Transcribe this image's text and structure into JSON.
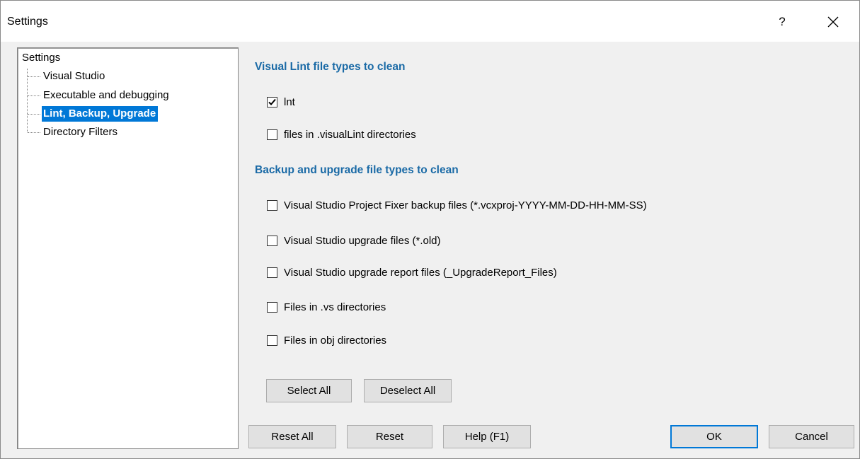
{
  "window": {
    "title": "Settings",
    "help_label": "?",
    "close_label": "✕"
  },
  "tree": {
    "root": "Settings",
    "items": [
      {
        "label": "Visual Studio",
        "selected": false
      },
      {
        "label": "Executable and debugging",
        "selected": false
      },
      {
        "label": "Lint, Backup, Upgrade",
        "selected": true
      },
      {
        "label": "Directory Filters",
        "selected": false
      }
    ]
  },
  "sections": {
    "lint_title": "Visual Lint file types to clean",
    "backup_title": "Backup and upgrade file types to clean"
  },
  "checkboxes": [
    {
      "label": "lnt",
      "checked": true
    },
    {
      "label": "files in .visualLint directories",
      "checked": false
    },
    {
      "label": "Visual Studio Project Fixer backup files (*.vcxproj-YYYY-MM-DD-HH-MM-SS)",
      "checked": false
    },
    {
      "label": "Visual Studio upgrade files (*.old)",
      "checked": false
    },
    {
      "label": "Visual Studio upgrade report files (_UpgradeReport_Files)",
      "checked": false
    },
    {
      "label": "Files in .vs directories",
      "checked": false
    },
    {
      "label": "Files in obj directories",
      "checked": false
    }
  ],
  "buttons": {
    "select_all": "Select All",
    "deselect_all": "Deselect All",
    "reset_all": "Reset All",
    "reset": "Reset",
    "help": "Help (F1)",
    "ok": "OK",
    "cancel": "Cancel"
  },
  "colors": {
    "accent": "#0078d7",
    "section_title": "#1a6aa6"
  }
}
